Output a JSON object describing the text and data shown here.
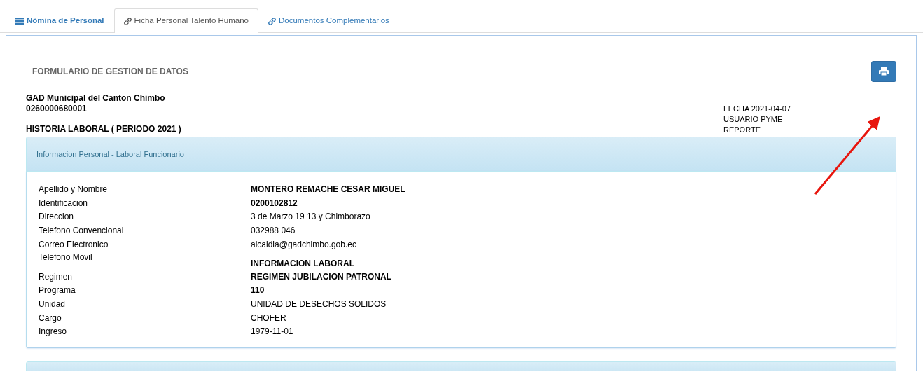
{
  "tabs": [
    {
      "label": "Nòmina de Personal",
      "selected": false
    },
    {
      "label": "Ficha Personal Talento Humano",
      "selected": true
    },
    {
      "label": "Documentos Complementarios",
      "selected": false
    }
  ],
  "form_title": "FORMULARIO DE GESTION DE DATOS",
  "company": {
    "name": "GAD Municipal del Canton Chimbo",
    "ruc": "0260000680001",
    "history": "HISTORIA LABORAL ( PERIODO 2021 )"
  },
  "report_info": [
    "FECHA 2021-04-07",
    "USUARIO PYME",
    "REPORTE"
  ],
  "panel": {
    "heading": "Informacion Personal - Laboral Funcionario",
    "rows": [
      {
        "kind": "field",
        "label": "Apellido y Nombre",
        "value": "MONTERO REMACHE CESAR MIGUEL",
        "bold": true
      },
      {
        "kind": "field",
        "label": "Identificacion",
        "value": "0200102812",
        "bold": true
      },
      {
        "kind": "field",
        "label": "Direccion",
        "value": "3 de Marzo 19 13 y Chimborazo",
        "bold": false
      },
      {
        "kind": "field",
        "label": "Telefono Convencional",
        "value": "032988 046",
        "bold": false
      },
      {
        "kind": "field",
        "label": "Correo Electronico",
        "value": "alcaldia@gadchimbo.gob.ec",
        "bold": false
      },
      {
        "kind": "section",
        "label": "Telefono Movil",
        "value": "INFORMACION LABORAL",
        "bold": true
      },
      {
        "kind": "field",
        "label": "Regimen",
        "value": "REGIMEN JUBILACION PATRONAL",
        "bold": true
      },
      {
        "kind": "field",
        "label": "Programa",
        "value": "110",
        "bold": true
      },
      {
        "kind": "field",
        "label": "Unidad",
        "value": "UNIDAD DE DESECHOS SOLIDOS",
        "bold": false
      },
      {
        "kind": "field",
        "label": "Cargo",
        "value": "CHOFER",
        "bold": false
      },
      {
        "kind": "field",
        "label": "Ingreso",
        "value": "1979-11-01",
        "bold": false
      }
    ]
  }
}
